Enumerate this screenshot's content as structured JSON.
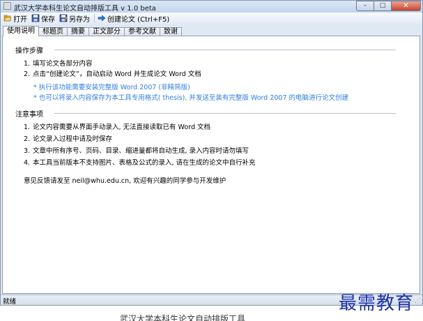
{
  "window": {
    "title": "武汉大学本科生论文自动排版工具 v 1.0 beta",
    "controls": {
      "minimize": "–",
      "maximize": "□",
      "close": "✕"
    }
  },
  "toolbar": {
    "open_label": "打开",
    "save_label": "保存",
    "saveas_label": "另存为",
    "create_label": "创建论文 (Ctrl+F5)"
  },
  "tabs": [
    "使用说明",
    "标题页",
    "摘要",
    "正文部分",
    "参考文献",
    "致谢"
  ],
  "instructions": {
    "steps_title": "操作步骤",
    "steps": [
      {
        "num": "1.",
        "text": "填写论文各部分内容"
      },
      {
        "num": "2.",
        "text": "点击“创建论文”，自动启动 Word 并生成论文 Word 文档"
      }
    ],
    "notes": [
      "* 执行该功能需要安装完整版 Word 2007 (非精简版)",
      "* 也可以将录入内容保存为本工具专用格式( thesis), 并发送至装有完整版 Word 2007 的电脑进行论文创建"
    ],
    "cautions_title": "注意事项",
    "cautions": [
      {
        "num": "1.",
        "text": "论文内容需要从界面手动录入, 无法直接读取已有 Word 文档"
      },
      {
        "num": "2.",
        "text": "论文录入过程中请及时保存"
      },
      {
        "num": "3.",
        "text": "文章中所有序号、页码、目录、缩进量都将自动生成, 录入内容时请勿填写"
      },
      {
        "num": "4.",
        "text": "本工具当前版本不支持图片、表格及公式的录入, 请在生成的论文中自行补充"
      }
    ],
    "feedback": "意见反馈请发至 neil@whu.edu.cn, 欢迎有兴趣的同学参与开发维护"
  },
  "status": {
    "text": "就绪"
  },
  "watermark": "最需教育",
  "caption": "武汉大学本科生论文自动排版工具",
  "colors": {
    "note_blue": "#2f7fe0",
    "watermark_blue": "#1a32a8"
  }
}
